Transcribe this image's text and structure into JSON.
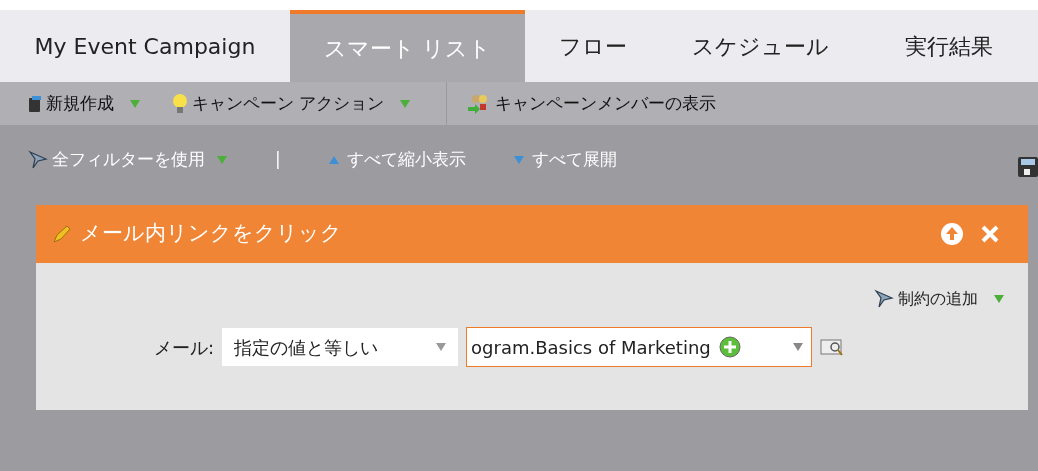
{
  "tabs": [
    {
      "label": "My Event Campaign",
      "selected": false
    },
    {
      "label": "スマート リスト",
      "selected": true
    },
    {
      "label": "フロー",
      "selected": false
    },
    {
      "label": "スケジュール",
      "selected": false
    },
    {
      "label": "実行結果",
      "selected": false
    }
  ],
  "toolbar": [
    {
      "label": "新規作成",
      "kind": "new",
      "dropdown": true
    },
    {
      "label": "キャンペーン アクション",
      "kind": "bulb",
      "dropdown": true
    },
    {
      "label": "キャンペーンメンバーの表示",
      "kind": "members",
      "dropdown": false
    }
  ],
  "filter_bar": {
    "use_filters": "全フィルターを使用",
    "separator": "|",
    "collapse_all": "すべて縮小表示",
    "expand_all": "すべて展開"
  },
  "filter": {
    "title": "メール内リンクをクリック",
    "add_constraint": "制約の追加",
    "field_label": "メール:",
    "operator": "指定の値と等しい",
    "value": "ogram.Basics of Marketing"
  }
}
